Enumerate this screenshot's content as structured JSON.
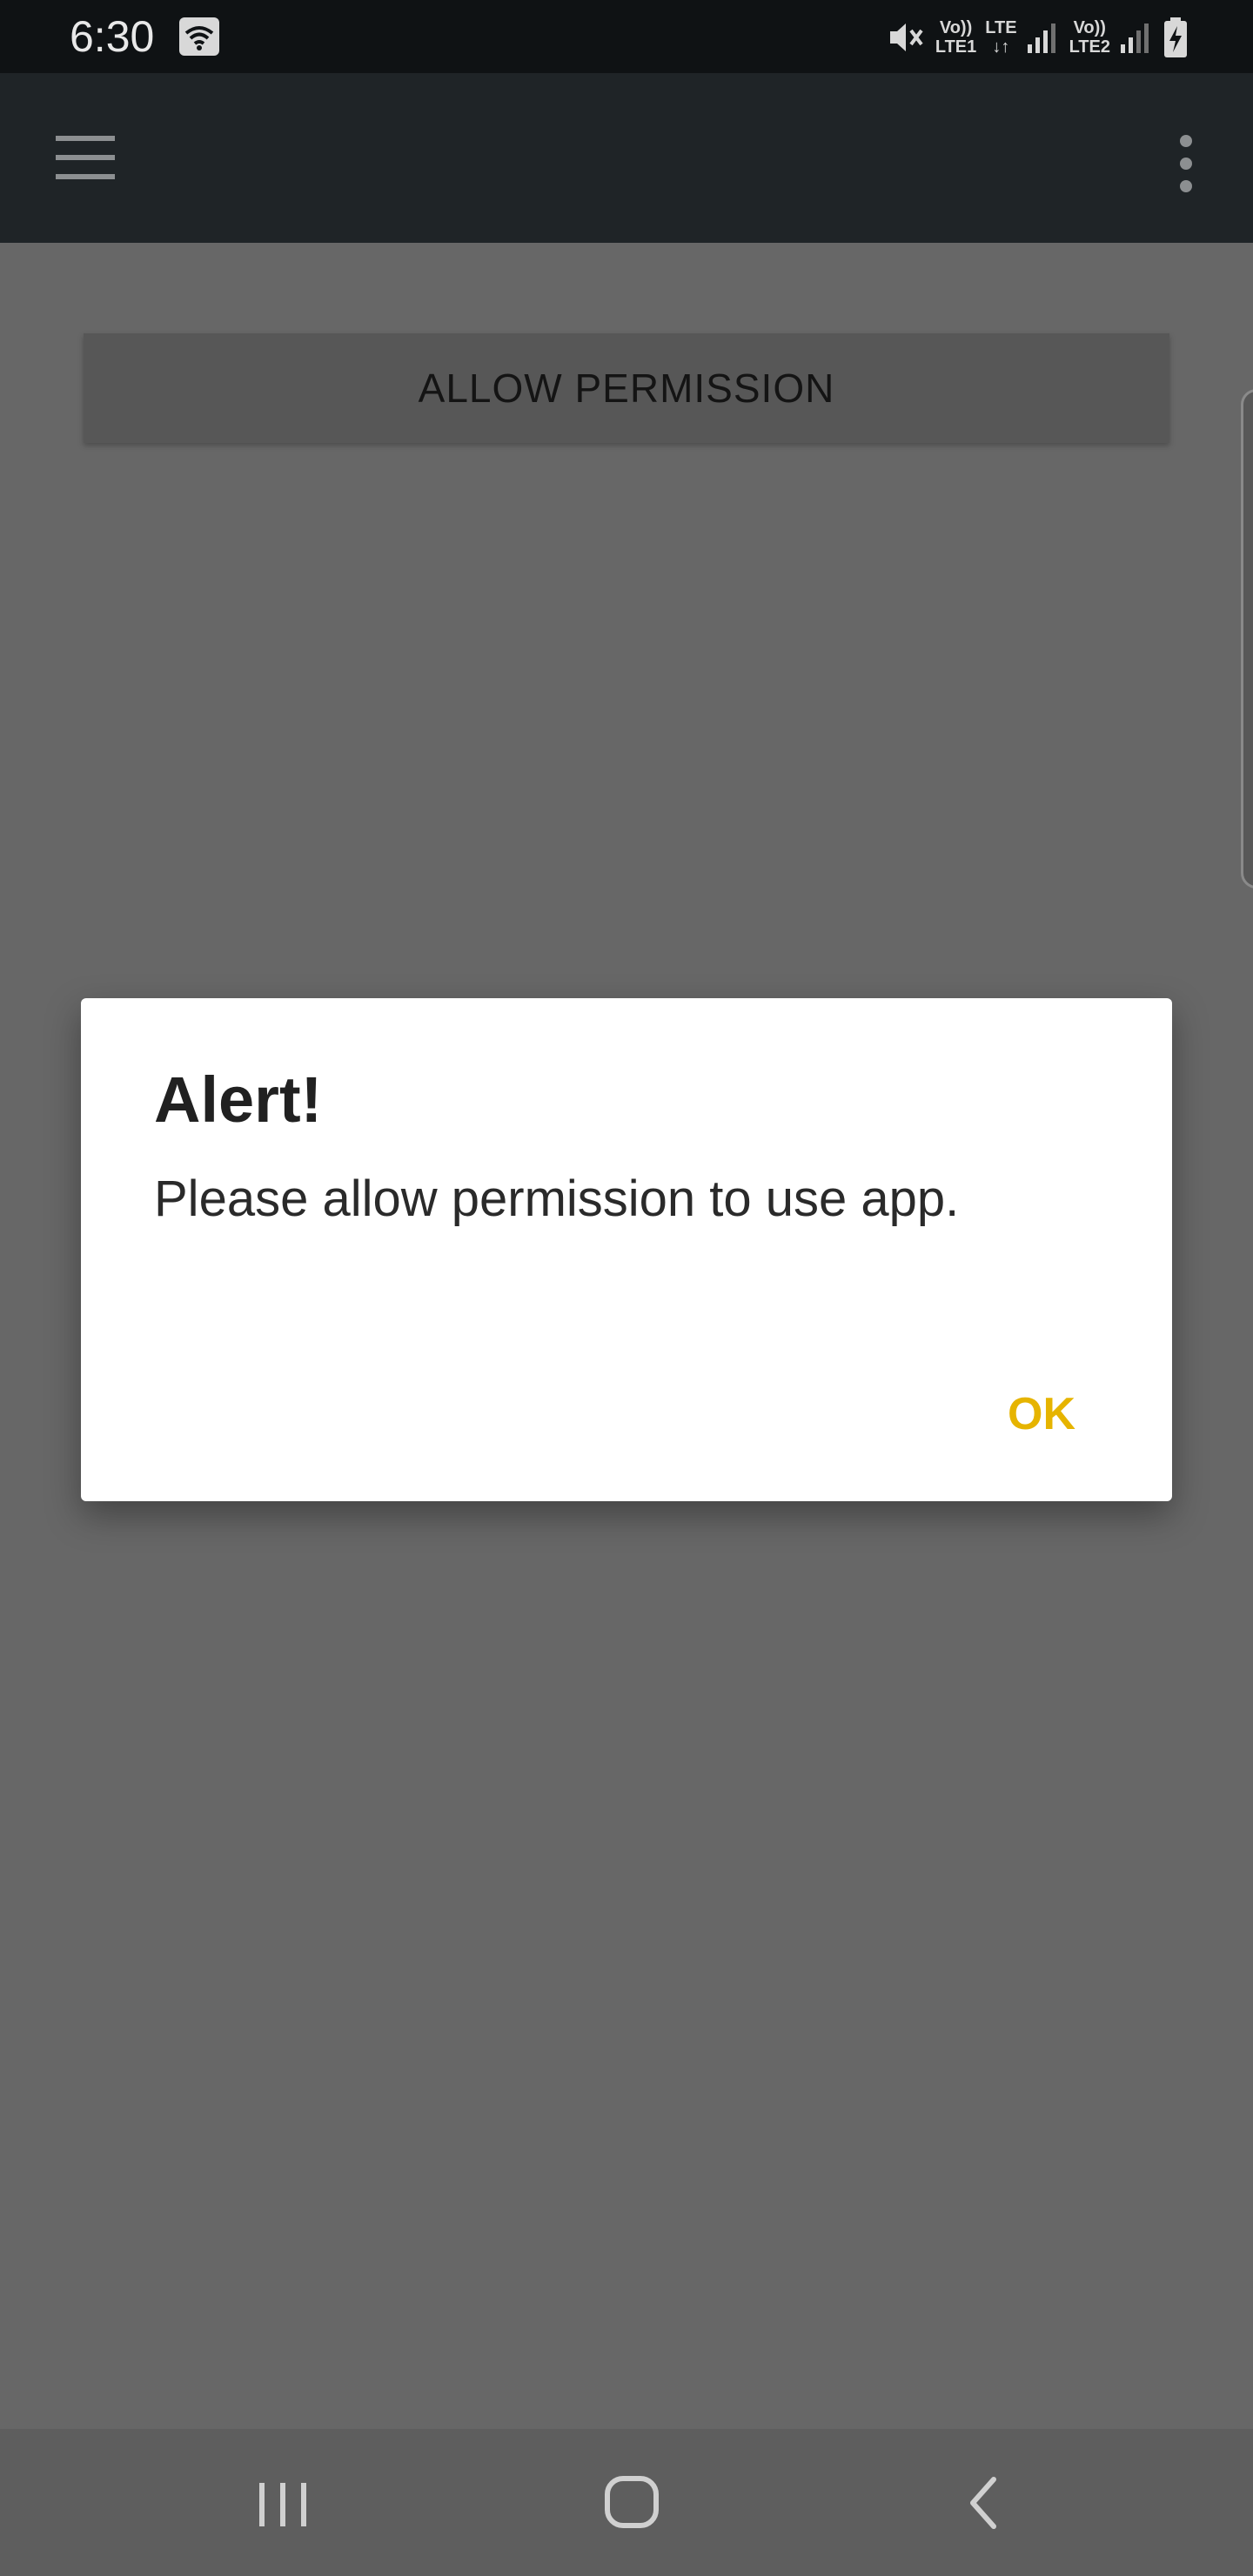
{
  "status_bar": {
    "time": "6:30",
    "wifi_icon": "wifi-icon",
    "mute_icon": "mute-icon",
    "sim1_label_top": "Vo))",
    "sim1_label_bottom": "LTE1",
    "data_label": "LTE",
    "sim2_label_top": "Vo))",
    "sim2_label_bottom": "LTE2",
    "battery_icon": "battery-charging-icon"
  },
  "toolbar": {
    "menu_icon": "hamburger-menu-icon",
    "overflow_icon": "more-vertical-icon"
  },
  "content": {
    "allow_button_label": "ALLOW PERMISSION"
  },
  "dialog": {
    "title": "Alert!",
    "message": "Please allow permission to use app.",
    "ok_label": "OK",
    "accent_color": "#e6b400"
  },
  "nav_bar": {
    "recents_icon": "recents-icon",
    "home_icon": "home-icon",
    "back_icon": "back-icon"
  }
}
